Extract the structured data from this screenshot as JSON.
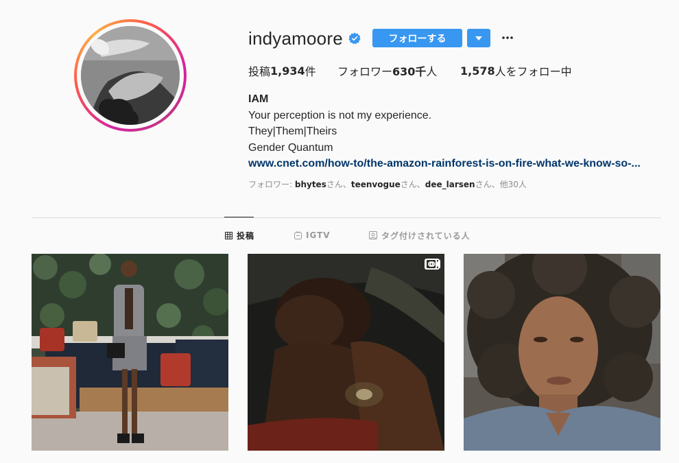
{
  "profile": {
    "username": "indyamoore",
    "verified": true,
    "follow_label": "フォローする",
    "stats": {
      "posts_label": "投稿",
      "posts_count": "1,934",
      "posts_suffix": "件",
      "followers_label": "フォロワー",
      "followers_count": "630千",
      "followers_suffix": "人",
      "following_count": "1,578",
      "following_suffix": "人をフォロー中"
    },
    "bio": {
      "name": "IAM",
      "line1": "Your perception is not my experience.",
      "line2": "They|Them|Theirs",
      "line3": "Gender Quantum",
      "link": "www.cnet.com/how-to/the-amazon-rainforest-is-on-fire-what-we-know-so-..."
    },
    "followed_by": {
      "prefix": "フォロワー: ",
      "user1": "bhytes",
      "sep1": "さん、",
      "user2": "teenvogue",
      "sep2": "さん、",
      "user3": "dee_larsen",
      "suffix": "さん、他30人"
    }
  },
  "tabs": [
    {
      "label": "投稿",
      "icon": "grid-icon",
      "active": true
    },
    {
      "label": "IGTV",
      "icon": "igtv-icon",
      "active": false
    },
    {
      "label": "タグ付けされている人",
      "icon": "tagged-icon",
      "active": false
    }
  ],
  "posts": [
    {
      "kind": "photo"
    },
    {
      "kind": "video",
      "icon": "video-icon"
    },
    {
      "kind": "photo"
    }
  ],
  "colors": {
    "accent": "#3897f0",
    "link": "#003569",
    "muted": "#8e8e8e",
    "divider": "#dbdbdb"
  }
}
